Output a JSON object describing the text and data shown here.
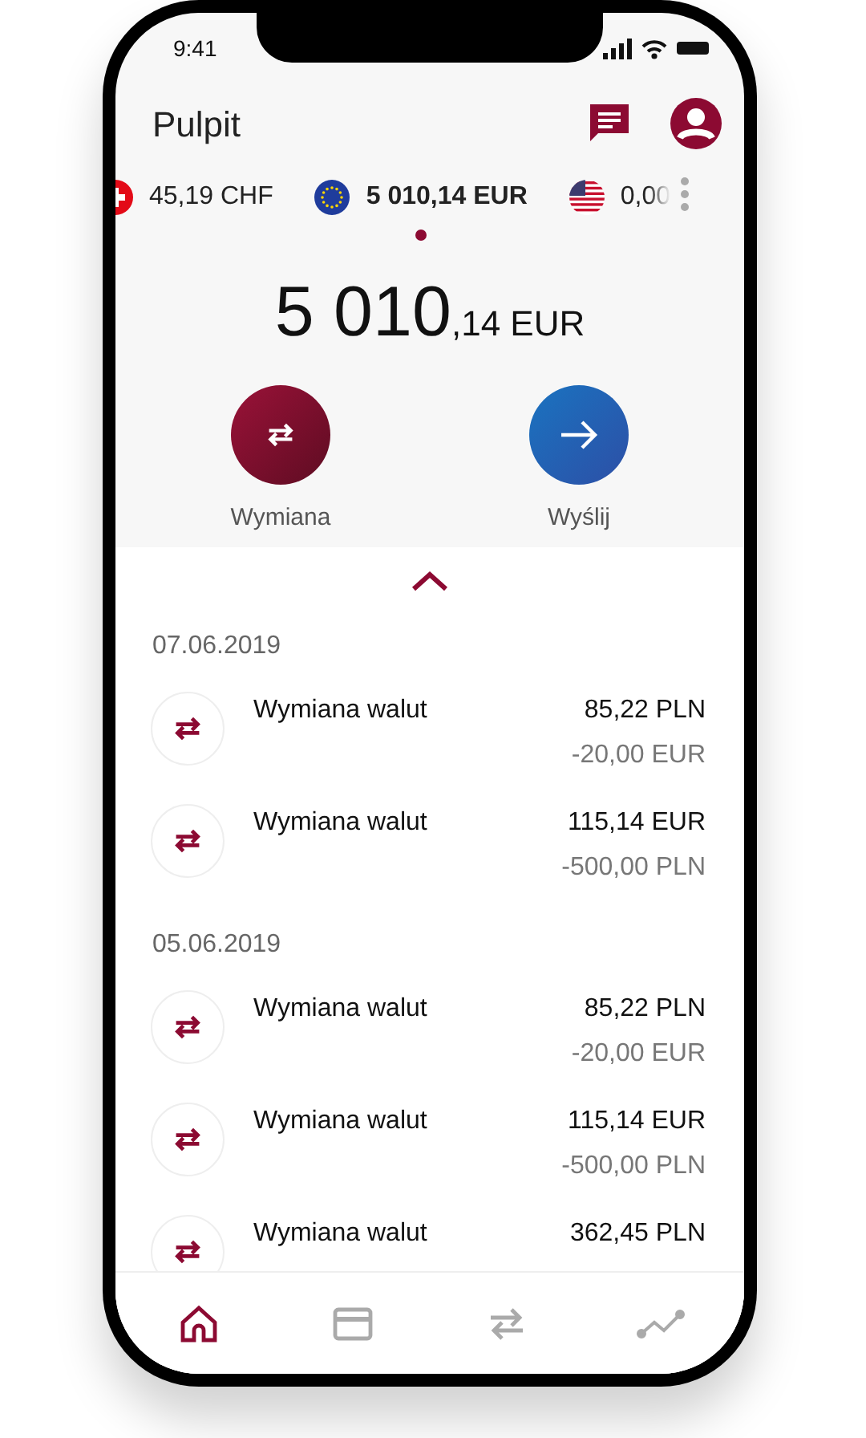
{
  "status_bar": {
    "time": "9:41"
  },
  "header": {
    "title": "Pulpit"
  },
  "currencies": [
    {
      "kind": "ch",
      "amount": "45,19 CHF",
      "selected": false
    },
    {
      "kind": "eu",
      "amount": "5 010,14 EUR",
      "selected": true
    },
    {
      "kind": "us",
      "amount": "0,00",
      "selected": false
    }
  ],
  "balance": {
    "whole": "5 010",
    "fraction": ",14 EUR"
  },
  "actions": [
    {
      "kind": "exchange",
      "label": "Wymiana"
    },
    {
      "kind": "send",
      "label": "Wyślij"
    }
  ],
  "groups": [
    {
      "date": "07.06.2019",
      "transactions": [
        {
          "title": "Wymiana walut",
          "amount": "85,22 PLN",
          "secondary": "-20,00 EUR"
        },
        {
          "title": "Wymiana walut",
          "amount": "115,14 EUR",
          "secondary": "-500,00 PLN"
        }
      ]
    },
    {
      "date": "05.06.2019",
      "transactions": [
        {
          "title": "Wymiana walut",
          "amount": "85,22 PLN",
          "secondary": "-20,00 EUR"
        },
        {
          "title": "Wymiana walut",
          "amount": "115,14 EUR",
          "secondary": "-500,00 PLN"
        },
        {
          "title": "Wymiana walut",
          "amount": "362,45 PLN"
        }
      ]
    }
  ],
  "nav": [
    {
      "kind": "home",
      "selected": true
    },
    {
      "kind": "card",
      "selected": false
    },
    {
      "kind": "transfer",
      "selected": false
    },
    {
      "kind": "chart",
      "selected": false
    }
  ]
}
